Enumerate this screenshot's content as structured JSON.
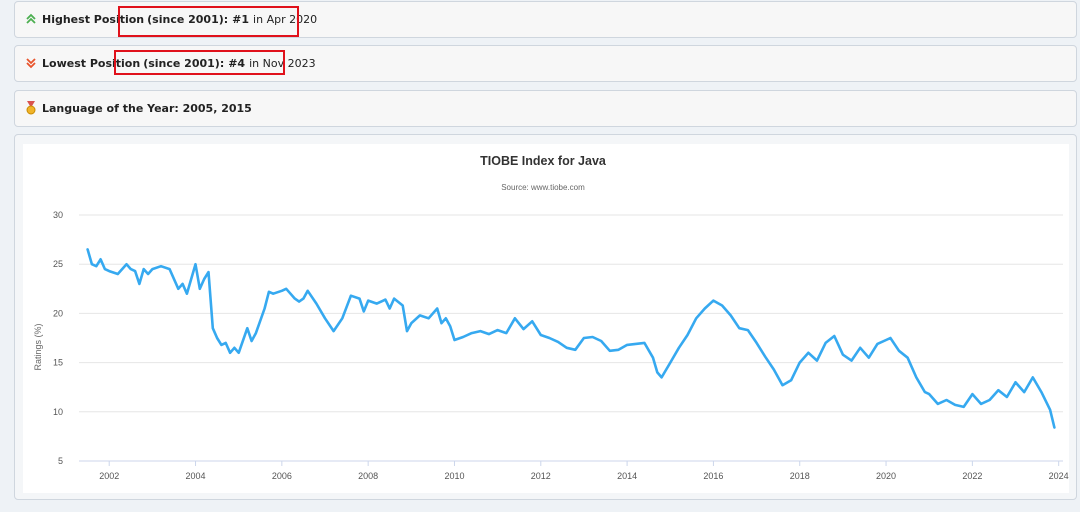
{
  "highest": {
    "icon": "double-chevron-up-icon",
    "label": "Highest Position",
    "since": "(since 2001):",
    "rank": "#1",
    "when": "in Apr 2020",
    "color": "#4caf50"
  },
  "lowest": {
    "icon": "double-chevron-down-icon",
    "label": "Lowest Position",
    "since": "(since 2001):",
    "rank": "#4",
    "when": "in Nov 2023",
    "color": "#e8542c"
  },
  "award": {
    "icon": "medal-icon",
    "label": "Language of the Year: 2005, 2015"
  },
  "highlight_color": "#e0111b",
  "chart_data": {
    "type": "line",
    "title": "TIOBE Index for Java",
    "subtitle": "Source: www.tiobe.com",
    "ylabel": "Ratings (%)",
    "xlabel": "",
    "ylim": [
      5,
      30
    ],
    "yticks": [
      5,
      10,
      15,
      20,
      25,
      30
    ],
    "xlim": [
      2001.3,
      2024.1
    ],
    "xticks": [
      2002,
      2004,
      2006,
      2008,
      2010,
      2012,
      2014,
      2016,
      2018,
      2020,
      2022,
      2024
    ],
    "grid": "horizontal",
    "legend": "none",
    "color": "#36a9f0",
    "series": [
      {
        "x": [
          2001.5,
          2001.6,
          2001.7,
          2001.8,
          2001.9,
          2002.0,
          2002.2,
          2002.4,
          2002.5,
          2002.6,
          2002.7,
          2002.8,
          2002.9,
          2003.0,
          2003.2,
          2003.4,
          2003.6,
          2003.7,
          2003.8,
          2003.9,
          2004.0,
          2004.1,
          2004.2,
          2004.3,
          2004.4,
          2004.5,
          2004.6,
          2004.7,
          2004.8,
          2004.9,
          2005.0,
          2005.2,
          2005.3,
          2005.4,
          2005.6,
          2005.7,
          2005.8,
          2006.0,
          2006.1,
          2006.2,
          2006.3,
          2006.4,
          2006.5,
          2006.6,
          2006.8,
          2007.0,
          2007.2,
          2007.4,
          2007.6,
          2007.8,
          2007.9,
          2008.0,
          2008.2,
          2008.4,
          2008.5,
          2008.6,
          2008.8,
          2008.9,
          2009.0,
          2009.2,
          2009.4,
          2009.6,
          2009.7,
          2009.8,
          2009.9,
          2010.0,
          2010.2,
          2010.4,
          2010.6,
          2010.8,
          2011.0,
          2011.2,
          2011.4,
          2011.6,
          2011.8,
          2012.0,
          2012.2,
          2012.4,
          2012.6,
          2012.8,
          2013.0,
          2013.2,
          2013.4,
          2013.6,
          2013.8,
          2014.0,
          2014.2,
          2014.4,
          2014.6,
          2014.7,
          2014.8,
          2015.0,
          2015.2,
          2015.4,
          2015.6,
          2015.8,
          2016.0,
          2016.2,
          2016.4,
          2016.6,
          2016.8,
          2017.0,
          2017.2,
          2017.4,
          2017.6,
          2017.8,
          2018.0,
          2018.2,
          2018.4,
          2018.6,
          2018.8,
          2019.0,
          2019.2,
          2019.4,
          2019.6,
          2019.8,
          2020.0,
          2020.1,
          2020.3,
          2020.5,
          2020.7,
          2020.9,
          2021.0,
          2021.2,
          2021.4,
          2021.6,
          2021.8,
          2022.0,
          2022.2,
          2022.4,
          2022.6,
          2022.8,
          2023.0,
          2023.2,
          2023.4,
          2023.6,
          2023.8,
          2023.9
        ],
        "y": [
          26.5,
          25.0,
          24.8,
          25.5,
          24.5,
          24.3,
          24.0,
          25.0,
          24.5,
          24.3,
          23.0,
          24.5,
          24.0,
          24.5,
          24.8,
          24.5,
          22.5,
          23.0,
          22.0,
          23.5,
          25.0,
          22.5,
          23.5,
          24.2,
          18.5,
          17.5,
          16.8,
          17.0,
          16.0,
          16.5,
          16.0,
          18.5,
          17.2,
          18.0,
          20.5,
          22.2,
          22.0,
          22.3,
          22.5,
          22.0,
          21.5,
          21.2,
          21.5,
          22.3,
          21.0,
          19.5,
          18.2,
          19.5,
          21.8,
          21.5,
          20.2,
          21.3,
          21.0,
          21.4,
          20.5,
          21.5,
          20.8,
          18.2,
          19.0,
          19.8,
          19.5,
          20.5,
          19.0,
          19.5,
          18.7,
          17.3,
          17.6,
          18.0,
          18.2,
          17.9,
          18.3,
          18.0,
          19.5,
          18.4,
          19.2,
          17.8,
          17.5,
          17.1,
          16.5,
          16.3,
          17.5,
          17.6,
          17.2,
          16.2,
          16.3,
          16.8,
          16.9,
          17.0,
          15.5,
          14.0,
          13.5,
          15.0,
          16.5,
          17.8,
          19.5,
          20.5,
          21.3,
          20.8,
          19.8,
          18.5,
          18.3,
          17.0,
          15.6,
          14.3,
          12.7,
          13.2,
          15.0,
          16.0,
          15.2,
          17.0,
          17.7,
          15.8,
          15.2,
          16.5,
          15.5,
          16.9,
          17.3,
          17.5,
          16.2,
          15.5,
          13.5,
          12.0,
          11.8,
          10.8,
          11.2,
          10.7,
          10.5,
          11.8,
          10.8,
          11.2,
          12.2,
          11.5,
          13.0,
          12.0,
          13.5,
          12.0,
          10.2,
          8.4
        ]
      }
    ]
  }
}
